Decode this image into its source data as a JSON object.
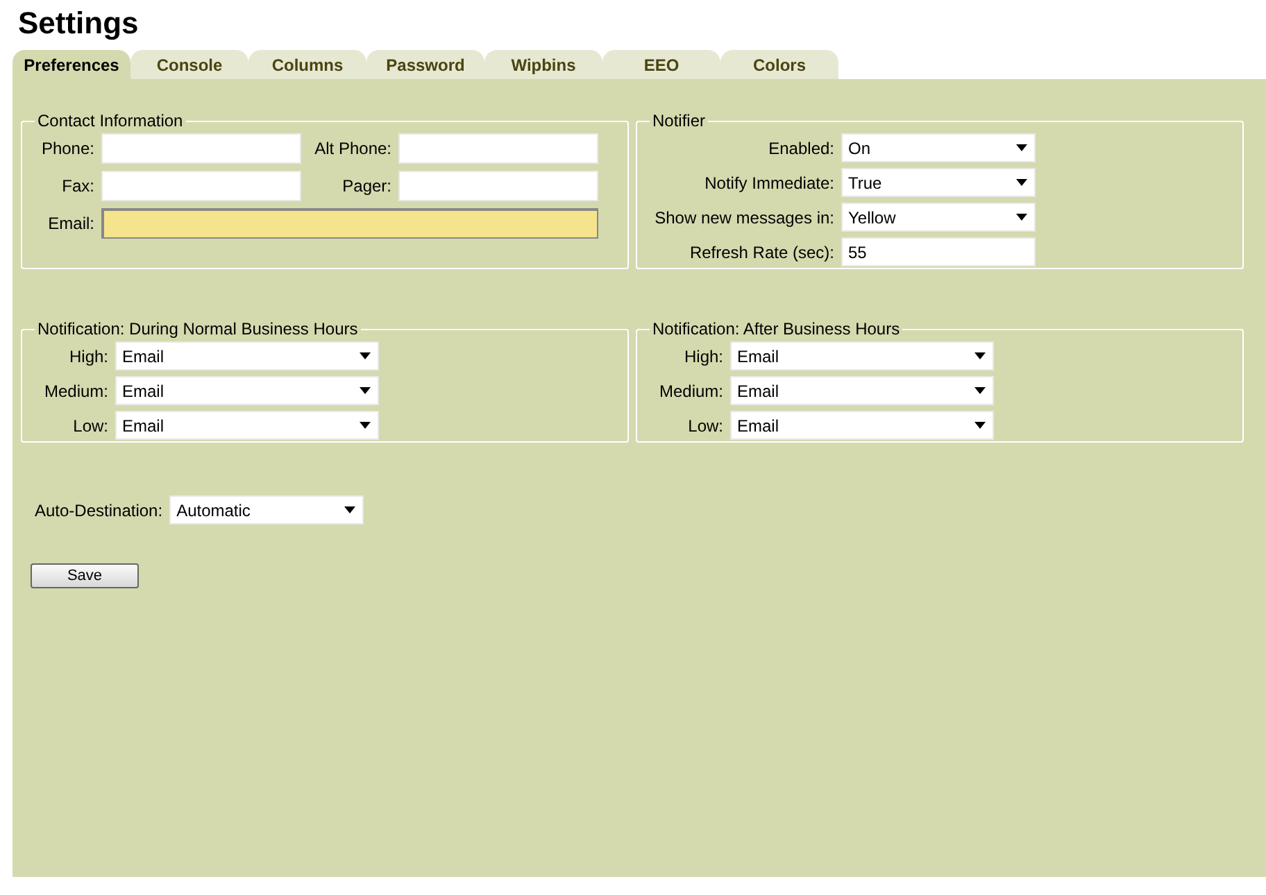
{
  "title": "Settings",
  "tabs": [
    {
      "label": "Preferences",
      "selected": true
    },
    {
      "label": "Console",
      "selected": false
    },
    {
      "label": "Columns",
      "selected": false
    },
    {
      "label": "Password",
      "selected": false
    },
    {
      "label": "Wipbins",
      "selected": false
    },
    {
      "label": "EEO",
      "selected": false
    },
    {
      "label": "Colors",
      "selected": false
    }
  ],
  "contact": {
    "legend": "Contact Information",
    "fields": [
      {
        "label": "Phone:",
        "highlighted": false
      },
      {
        "label": "Alt Phone:",
        "highlighted": false
      },
      {
        "label": "Fax:",
        "highlighted": false
      },
      {
        "label": "Pager:",
        "highlighted": false
      }
    ],
    "email": {
      "label": "Email:",
      "highlighted": true
    }
  },
  "notifier": {
    "legend": "Notifier",
    "rows": [
      {
        "kind": "select",
        "label": "Enabled:",
        "value": "On"
      },
      {
        "kind": "select",
        "label": "Notify Immediate:",
        "value": "True"
      },
      {
        "kind": "select",
        "label": "Show new messages in:",
        "value": "Yellow"
      },
      {
        "kind": "text",
        "label": "Refresh Rate (sec):",
        "value": "55"
      }
    ]
  },
  "business_hours": {
    "legend": "Notification: During Normal Business Hours",
    "rows": [
      {
        "label": "High:",
        "value": "Email"
      },
      {
        "label": "Medium:",
        "value": "Email"
      },
      {
        "label": "Low:",
        "value": "Email"
      }
    ]
  },
  "after_hours": {
    "legend": "Notification: After Business Hours",
    "rows": [
      {
        "label": "High:",
        "value": "Email"
      },
      {
        "label": "Medium:",
        "value": "Email"
      },
      {
        "label": "Low:",
        "value": "Email"
      }
    ]
  },
  "auto_destination": {
    "label": "Auto-Destination:",
    "value": "Automatic"
  },
  "save_button": "Save"
}
